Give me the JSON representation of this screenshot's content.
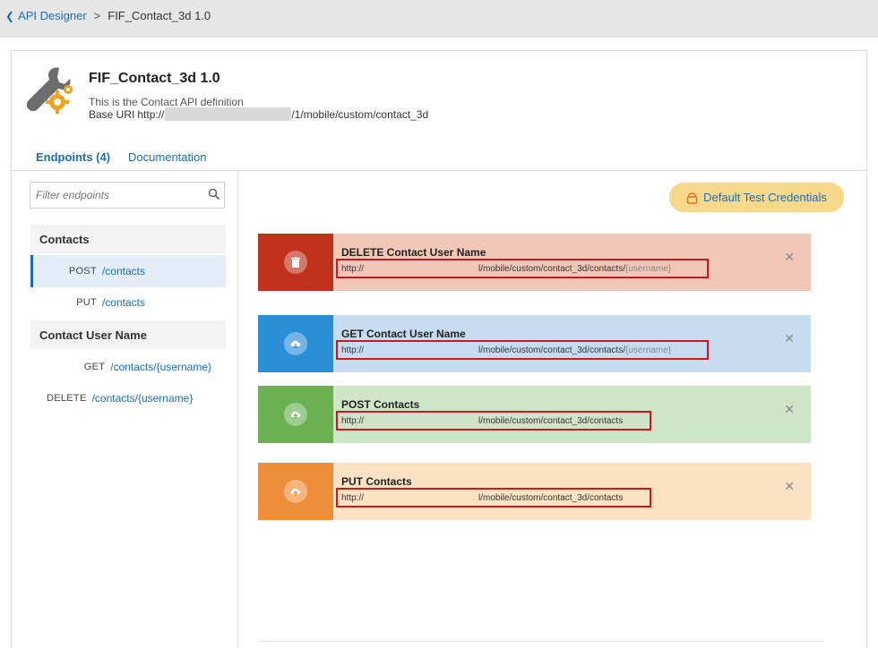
{
  "breadcrumb": {
    "back_label": "API Designer",
    "separator": ">",
    "current": "FIF_Contact_3d 1.0"
  },
  "api": {
    "title": "FIF_Contact_3d 1.0",
    "description": "This is the Contact API definition",
    "base_uri_label": "Base URI",
    "base_uri_prefix": "http://",
    "base_uri_suffix": "/1/mobile/custom/contact_3d"
  },
  "tabs": [
    {
      "label": "Endpoints (4)",
      "active": true
    },
    {
      "label": "Documentation",
      "active": false
    }
  ],
  "filter": {
    "placeholder": "Filter endpoints",
    "value": ""
  },
  "sidebar": {
    "groups": [
      {
        "header": "Contacts",
        "items": [
          {
            "method": "POST",
            "path": "/contacts",
            "active": true
          },
          {
            "method": "PUT",
            "path": "/contacts",
            "active": false
          }
        ]
      },
      {
        "header": "Contact User Name",
        "items": [
          {
            "method": "GET",
            "path": "/contacts/{username}",
            "active": false
          },
          {
            "method": "DELETE",
            "path": "/contacts/{username}",
            "active": false
          }
        ]
      }
    ]
  },
  "credentials_button": {
    "label": "Default Test Credentials",
    "icon": "lock-icon"
  },
  "endpoints": [
    {
      "name": "DELETE Contact User Name",
      "url_prefix": "http://",
      "url_path": "l/mobile/custom/contact_3d/contacts/",
      "url_param": "{username}",
      "color": "#c0301a",
      "icon": "trash-icon"
    },
    {
      "name": "GET Contact User Name",
      "url_prefix": "http://",
      "url_path": "l/mobile/custom/contact_3d/contacts/",
      "url_param": "{username}",
      "color": "#2b8fd6",
      "icon": "cloud-download-icon"
    },
    {
      "name": "POST Contacts",
      "url_prefix": "http://",
      "url_path": "l/mobile/custom/contact_3d/contacts",
      "url_param": "",
      "color": "#6bb151",
      "icon": "cloud-upload-icon"
    },
    {
      "name": "PUT Contacts",
      "url_prefix": "http://",
      "url_path": "l/mobile/custom/contact_3d/contacts",
      "url_param": "",
      "color": "#ee8e3a",
      "icon": "cloud-upload-icon"
    }
  ],
  "close_glyph": "✕"
}
